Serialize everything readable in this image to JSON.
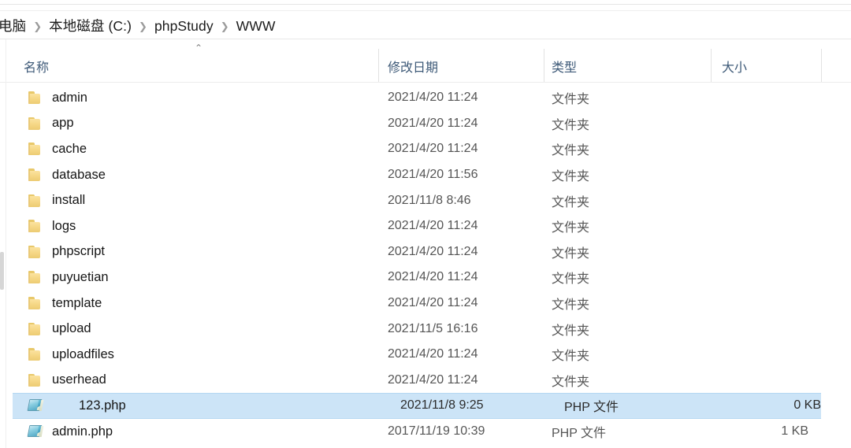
{
  "window": {
    "app": "Windows File Explorer"
  },
  "breadcrumb": {
    "separator": "❯",
    "items": [
      {
        "label": "电脑"
      },
      {
        "label": "本地磁盘 (C:)"
      },
      {
        "label": "phpStudy"
      },
      {
        "label": "WWW"
      }
    ]
  },
  "columns": {
    "sort_indicator": "⌃",
    "headers": [
      {
        "key": "name",
        "label": "名称"
      },
      {
        "key": "date",
        "label": "修改日期"
      },
      {
        "key": "type",
        "label": "类型"
      },
      {
        "key": "size",
        "label": "大小"
      }
    ]
  },
  "types": {
    "folder": "文件夹",
    "php": "PHP 文件"
  },
  "colors": {
    "selection": "#cce4f7",
    "selection_border": "#b5d8f2",
    "header_text": "#3e5a78",
    "folder_icon": "#f5d684",
    "php_icon": "#6fc3da"
  },
  "files": [
    {
      "name": "admin",
      "date": "2021/4/20 11:24",
      "type": "文件夹",
      "size": "",
      "icon": "folder-icon",
      "selected": false
    },
    {
      "name": "app",
      "date": "2021/4/20 11:24",
      "type": "文件夹",
      "size": "",
      "icon": "folder-icon",
      "selected": false
    },
    {
      "name": "cache",
      "date": "2021/4/20 11:24",
      "type": "文件夹",
      "size": "",
      "icon": "folder-icon",
      "selected": false
    },
    {
      "name": "database",
      "date": "2021/4/20 11:56",
      "type": "文件夹",
      "size": "",
      "icon": "folder-icon",
      "selected": false
    },
    {
      "name": "install",
      "date": "2021/11/8 8:46",
      "type": "文件夹",
      "size": "",
      "icon": "folder-icon",
      "selected": false
    },
    {
      "name": "logs",
      "date": "2021/4/20 11:24",
      "type": "文件夹",
      "size": "",
      "icon": "folder-icon",
      "selected": false
    },
    {
      "name": "phpscript",
      "date": "2021/4/20 11:24",
      "type": "文件夹",
      "size": "",
      "icon": "folder-icon",
      "selected": false
    },
    {
      "name": "puyuetian",
      "date": "2021/4/20 11:24",
      "type": "文件夹",
      "size": "",
      "icon": "folder-icon",
      "selected": false
    },
    {
      "name": "template",
      "date": "2021/4/20 11:24",
      "type": "文件夹",
      "size": "",
      "icon": "folder-icon",
      "selected": false
    },
    {
      "name": "upload",
      "date": "2021/11/5 16:16",
      "type": "文件夹",
      "size": "",
      "icon": "folder-icon",
      "selected": false
    },
    {
      "name": "uploadfiles",
      "date": "2021/4/20 11:24",
      "type": "文件夹",
      "size": "",
      "icon": "folder-icon",
      "selected": false
    },
    {
      "name": "userhead",
      "date": "2021/4/20 11:24",
      "type": "文件夹",
      "size": "",
      "icon": "folder-icon",
      "selected": false
    },
    {
      "name": "123.php",
      "date": "2021/11/8 9:25",
      "type": "PHP 文件",
      "size": "0 KB",
      "icon": "php-file-icon",
      "selected": true
    },
    {
      "name": "admin.php",
      "date": "2017/11/19 10:39",
      "type": "PHP 文件",
      "size": "1 KB",
      "icon": "php-file-icon",
      "selected": false
    }
  ]
}
